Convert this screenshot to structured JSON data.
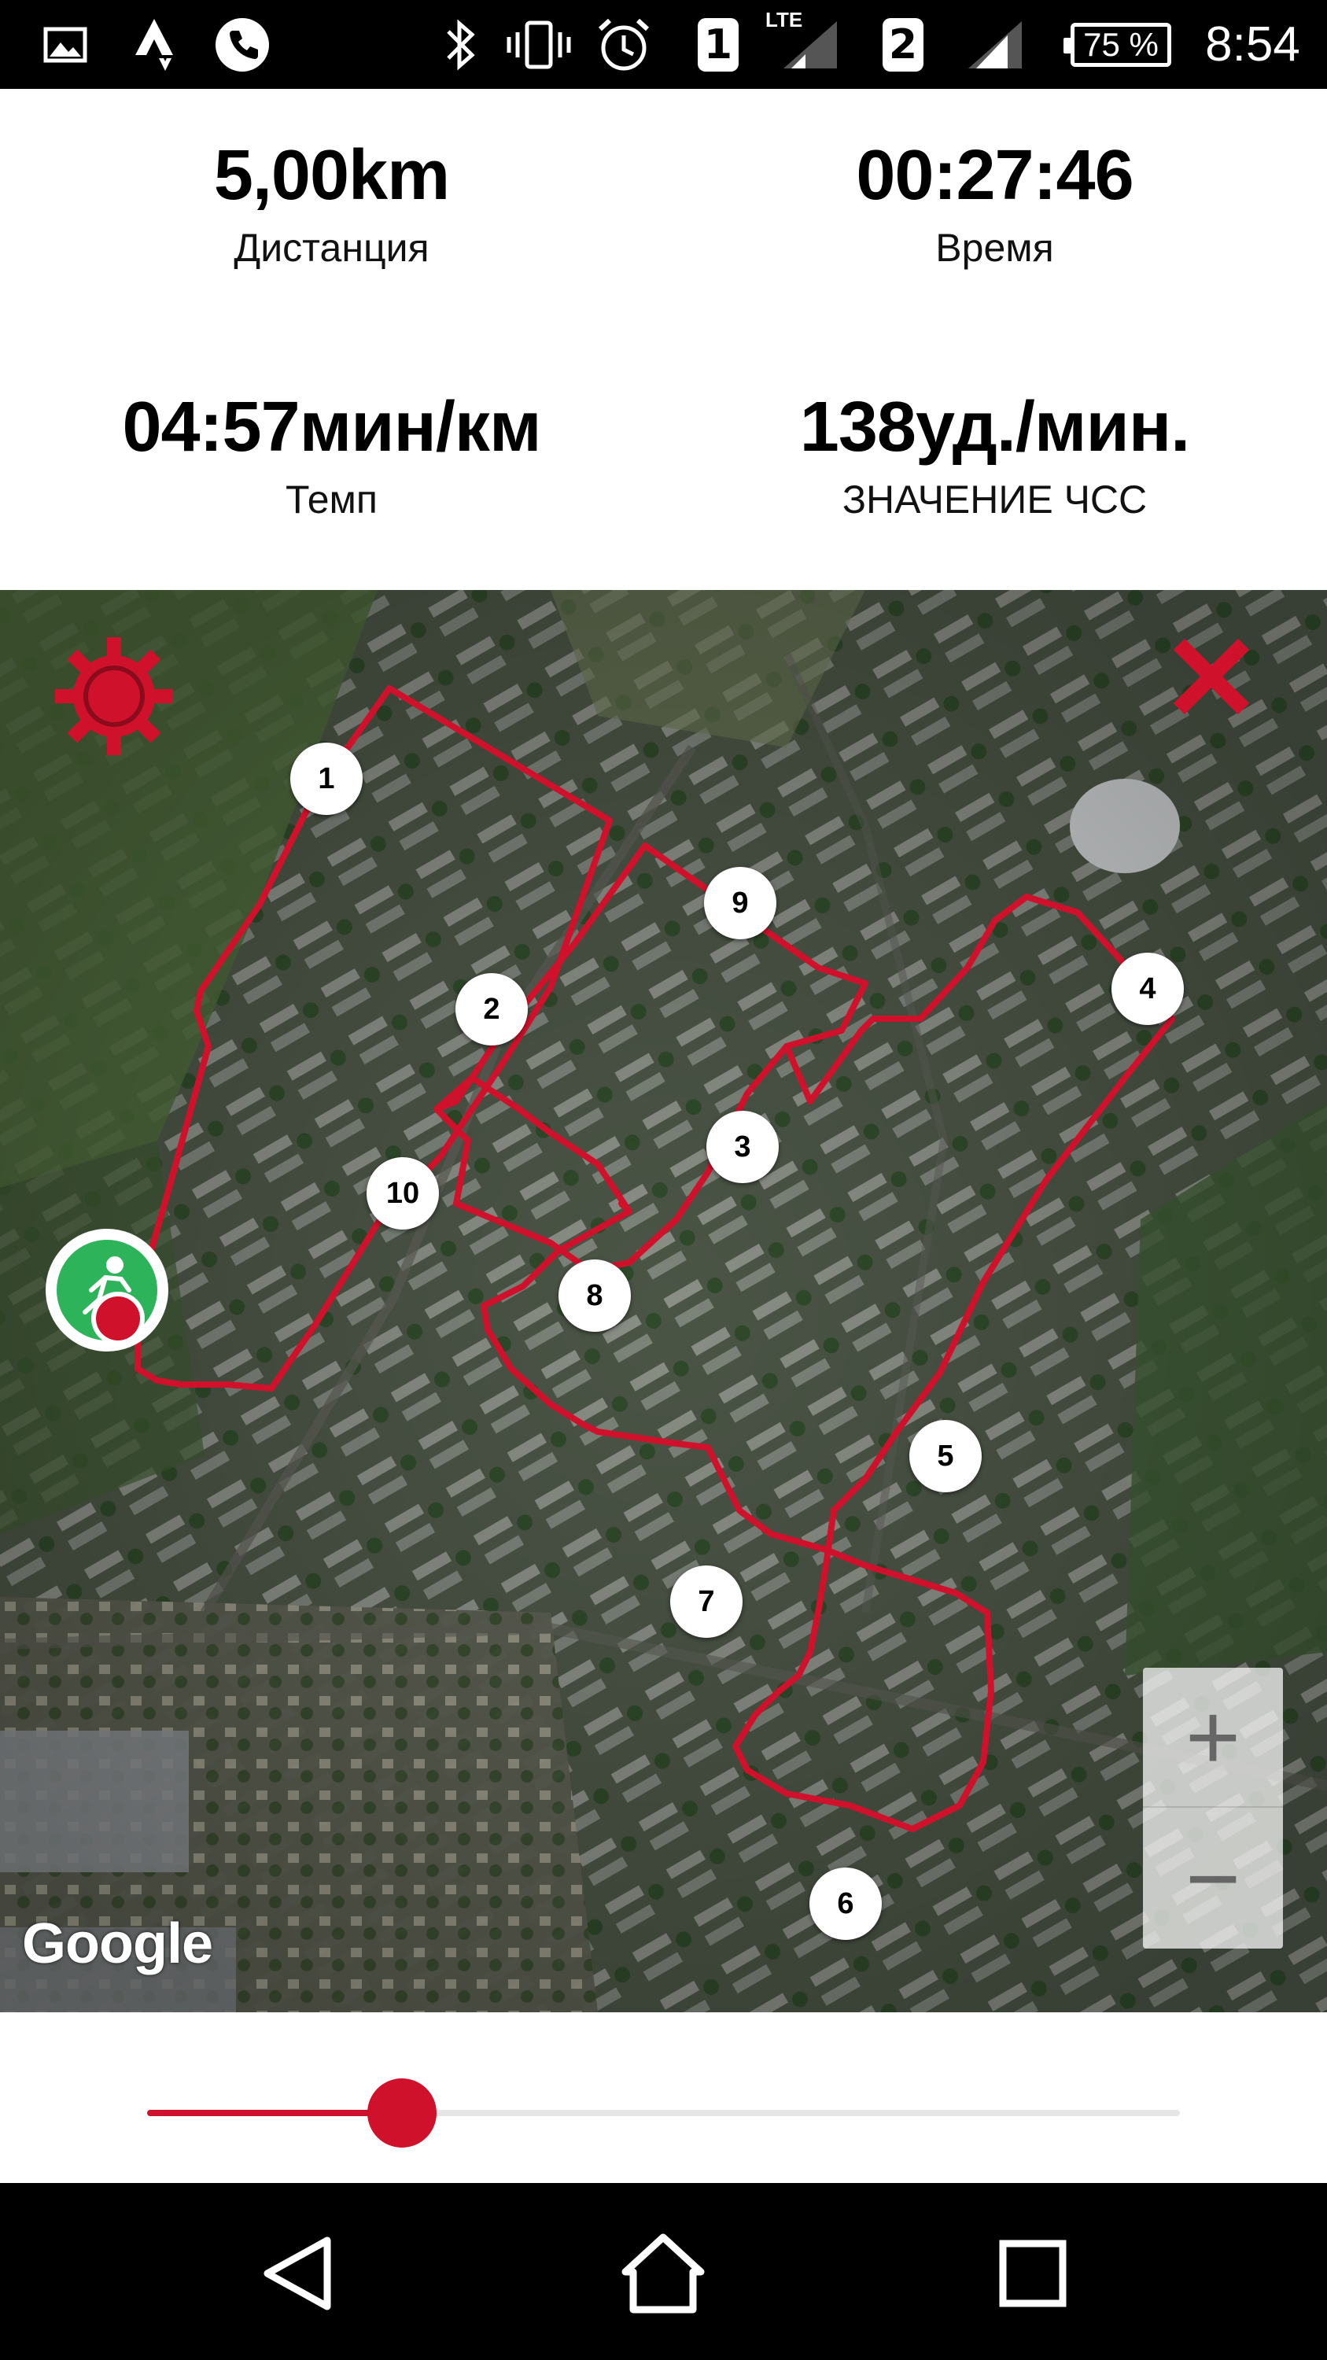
{
  "status_bar": {
    "time": "8:54",
    "battery": "75 %",
    "sim1": "1",
    "sim2": "2",
    "network": "LTE",
    "icons": [
      "gallery-icon",
      "strava-icon",
      "phone-icon",
      "bluetooth-icon",
      "vibrate-icon",
      "alarm-icon",
      "signal-icon",
      "battery-icon"
    ]
  },
  "stats": {
    "distance": {
      "value": "5,00km",
      "label": "Дистанция"
    },
    "time": {
      "value": "00:27:46",
      "label": "Время"
    },
    "pace": {
      "value": "04:57мин/км",
      "label": "Темп"
    },
    "heart_rate": {
      "value": "138уд./мин.",
      "label": "ЗНАЧЕНИЕ ЧСС"
    }
  },
  "map": {
    "attribution": "Google",
    "route_color": "#d0112b",
    "markers": [
      "1",
      "2",
      "3",
      "4",
      "5",
      "6",
      "7",
      "8",
      "9",
      "10"
    ],
    "zoom_in": "+",
    "zoom_out": "−"
  },
  "slider": {
    "progress": 0.247,
    "color": "#d0112b"
  },
  "colors": {
    "accent": "#d0112b",
    "start_marker": "#2db35a"
  }
}
